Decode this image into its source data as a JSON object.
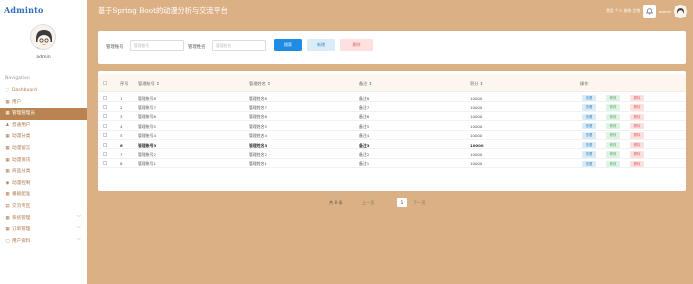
{
  "app": {
    "logo": "Adminto",
    "title": "基于Spring Boot的动漫分析与交流平台"
  },
  "sidebar": {
    "admin_name": "admin",
    "nav_title": "Navigation",
    "items": [
      {
        "label": "Dashboard",
        "icon": "dashboard-icon",
        "glyph": "◌",
        "active": false,
        "chevron": false
      },
      {
        "label": "用户",
        "icon": "grid-icon",
        "glyph": "▦",
        "active": false,
        "chevron": false
      },
      {
        "label": "管理管理员",
        "icon": "grid-icon",
        "glyph": "▦",
        "active": true,
        "chevron": false
      },
      {
        "label": "普通用户",
        "icon": "users-icon",
        "glyph": "♟",
        "active": false,
        "chevron": false
      },
      {
        "label": "动漫分类",
        "icon": "grid-icon",
        "glyph": "▦",
        "active": false,
        "chevron": false
      },
      {
        "label": "动漫留言",
        "icon": "grid-icon",
        "glyph": "▦",
        "active": false,
        "chevron": false
      },
      {
        "label": "动漫资讯",
        "icon": "grid-icon",
        "glyph": "▦",
        "active": false,
        "chevron": false
      },
      {
        "label": "商品分类",
        "icon": "grid-icon",
        "glyph": "▦",
        "active": false,
        "chevron": false
      },
      {
        "label": "动漫控制",
        "icon": "circle-icon",
        "glyph": "◉",
        "active": false,
        "chevron": false
      },
      {
        "label": "番剧配准",
        "icon": "grid-icon",
        "glyph": "▦",
        "active": false,
        "chevron": false
      },
      {
        "label": "交流专区",
        "icon": "book-icon",
        "glyph": "▤",
        "active": false,
        "chevron": false
      },
      {
        "label": "系统管理",
        "icon": "grid-icon",
        "glyph": "▦",
        "active": false,
        "chevron": true
      },
      {
        "label": "订单管理",
        "icon": "grid-icon",
        "glyph": "▦",
        "active": false,
        "chevron": true
      },
      {
        "label": "用户资料",
        "icon": "file-icon",
        "glyph": "▢",
        "active": false,
        "chevron": true
      }
    ]
  },
  "topbar": {
    "links": "首页 个人 修改 注销 ",
    "username": "admin"
  },
  "search": {
    "label1": "管理账号",
    "placeholder1": "管理账号",
    "label2": "管理姓名",
    "placeholder2": "管理姓名",
    "search_label": "搜索",
    "add_label": "新增",
    "delete_label": "删除"
  },
  "table": {
    "headers": {
      "index": "序号",
      "account": "管理账号 ⇕",
      "name": "管理姓名 ⇕",
      "note": "备注 ⇕",
      "points": "积分 ⇕",
      "actions": "操作"
    },
    "rows": [
      {
        "index": "1",
        "account": "管理账号8",
        "name": "管理姓名8",
        "note": "备注8",
        "points": "10000",
        "bold": false
      },
      {
        "index": "2",
        "account": "管理账号7",
        "name": "管理姓名7",
        "note": "备注7",
        "points": "10000",
        "bold": false
      },
      {
        "index": "3",
        "account": "管理账号6",
        "name": "管理姓名6",
        "note": "备注6",
        "points": "10000",
        "bold": false
      },
      {
        "index": "4",
        "account": "管理账号5",
        "name": "管理姓名5",
        "note": "备注5",
        "points": "10000",
        "bold": false
      },
      {
        "index": "5",
        "account": "管理账号4",
        "name": "管理姓名4",
        "note": "备注4",
        "points": "10000",
        "bold": false
      },
      {
        "index": "6",
        "account": "管理账号3",
        "name": "管理姓名3",
        "note": "备注3",
        "points": "10000",
        "bold": true
      },
      {
        "index": "7",
        "account": "管理账号2",
        "name": "管理姓名2",
        "note": "备注2",
        "points": "10000",
        "bold": false
      },
      {
        "index": "8",
        "account": "管理账号1",
        "name": "管理姓名1",
        "note": "备注1",
        "points": "10000",
        "bold": false
      }
    ],
    "action_labels": {
      "detail": "查看",
      "edit": "修改",
      "delete": "删除"
    }
  },
  "pager": {
    "total": "共 8 条",
    "prev": "上一页",
    "current": "1",
    "next": "下一页"
  },
  "colors": {
    "background": "#dcb085",
    "active_nav": "#b98451",
    "primary": "#1e8ce4"
  }
}
